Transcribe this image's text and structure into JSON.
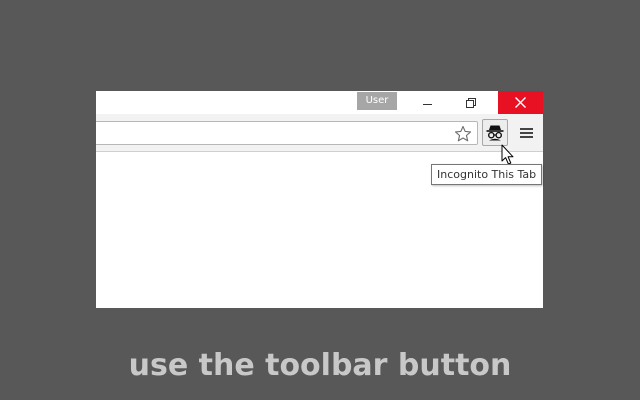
{
  "window": {
    "user_label": "User",
    "close_color": "#e81123"
  },
  "toolbar": {
    "icons": {
      "bookmark": "star-icon",
      "incognito": "incognito-icon",
      "menu": "hamburger-menu-icon"
    },
    "tooltip": "Incognito This Tab"
  },
  "caption": "use the toolbar button",
  "colors": {
    "background": "#585858",
    "caption": "#c8c8c8"
  }
}
